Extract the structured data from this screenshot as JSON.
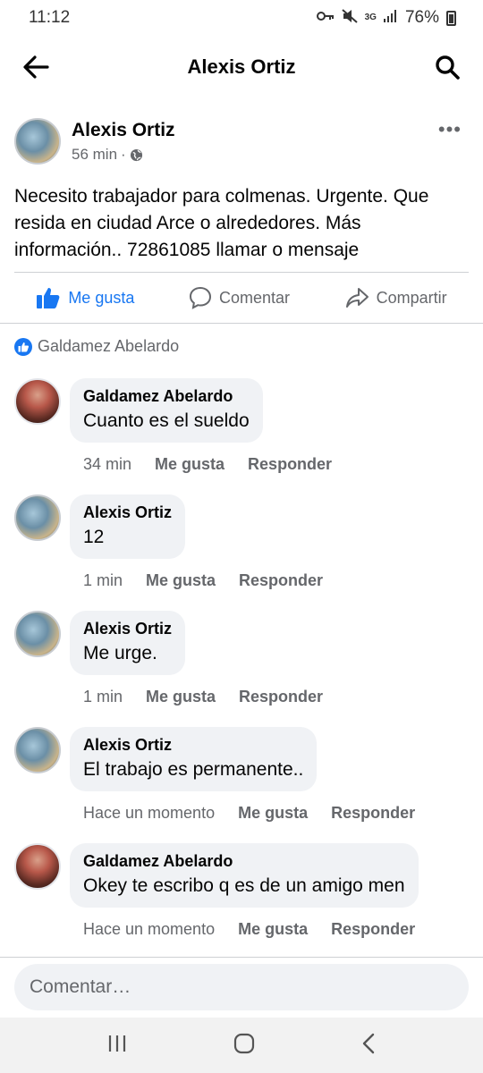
{
  "status": {
    "time": "11:12",
    "network": "3G",
    "battery": "76%",
    "icons": [
      "key-icon",
      "mute-icon",
      "data-icon",
      "signal-icon",
      "battery-icon"
    ]
  },
  "topbar": {
    "title": "Alexis Ortiz",
    "back_icon": "back-arrow-icon",
    "search_icon": "search-icon"
  },
  "post": {
    "author": "Alexis Ortiz",
    "time": "56 min",
    "separator": "·",
    "privacy_icon": "globe-icon",
    "more": "•••",
    "text": "Necesito trabajador para  colmenas. Urgente. Que resida en ciudad Arce o alrededores. Más información.. 72861085 llamar o mensaje"
  },
  "actions": {
    "like": "Me gusta",
    "comment": "Comentar",
    "share": "Compartir"
  },
  "reactions": {
    "names": "Galdamez Abelardo"
  },
  "comments": [
    {
      "name": "Galdamez Abelardo",
      "text": "Cuanto es el sueldo",
      "time": "34 min",
      "like": "Me gusta",
      "reply": "Responder"
    },
    {
      "name": "Alexis Ortiz",
      "text": "12",
      "time": "1 min",
      "like": "Me gusta",
      "reply": "Responder"
    },
    {
      "name": "Alexis Ortiz",
      "text": "Me  urge.",
      "time": "1 min",
      "like": "Me gusta",
      "reply": "Responder"
    },
    {
      "name": "Alexis Ortiz",
      "text": "El trabajo es permanente..",
      "time": "Hace un momento",
      "like": "Me gusta",
      "reply": "Responder"
    },
    {
      "name": "Galdamez Abelardo",
      "text": "Okey te escribo q es de un amigo men",
      "time": "Hace un momento",
      "like": "Me gusta",
      "reply": "Responder"
    }
  ],
  "composer": {
    "placeholder": "Comentar…"
  },
  "colors": {
    "accent": "#1877f2",
    "secondary_text": "#65676b",
    "bubble": "#f0f2f5"
  }
}
